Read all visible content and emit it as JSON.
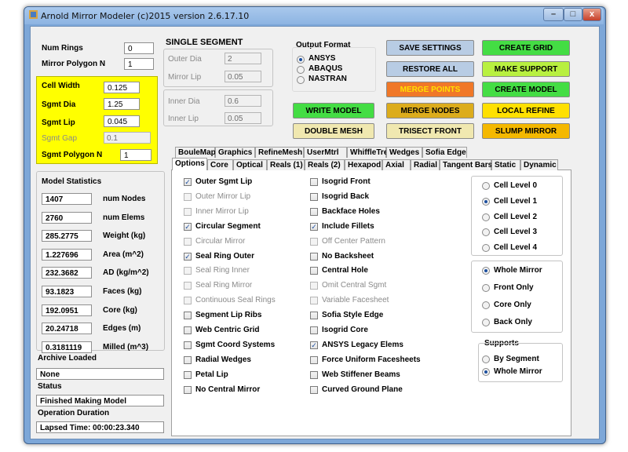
{
  "window": {
    "title": "Arnold Mirror Modeler (c)2015  version 2.6.17.10",
    "controls": {
      "minimize": "–",
      "maximize": "□",
      "close": "x"
    }
  },
  "left": {
    "num_rings_label": "Num Rings",
    "num_rings": "0",
    "mirror_polygon_label": "Mirror Polygon N",
    "mirror_polygon": "1",
    "cell_width_label": "Cell Width",
    "cell_width": "0.125",
    "sgmt_dia_label": "Sgmt Dia",
    "sgmt_dia": "1.25",
    "sgmt_lip_label": "Sgmt Lip",
    "sgmt_lip": "0.045",
    "sgmt_gap_label": "Sgmt Gap",
    "sgmt_gap": "0.1",
    "sgmt_polygon_label": "Sgmt Polygon N",
    "sgmt_polygon": "1"
  },
  "single_segment": {
    "title": "SINGLE SEGMENT",
    "outer_dia_label": "Outer Dia",
    "outer_dia": "2",
    "mirror_lip_label": "Mirror Lip",
    "mirror_lip": "0.05",
    "inner_dia_label": "Inner Dia",
    "inner_dia": "0.6",
    "inner_lip_label": "Inner Lip",
    "inner_lip": "0.05"
  },
  "output_format": {
    "title": "Output Format",
    "options": [
      "ANSYS",
      "ABAQUS",
      "NASTRAN"
    ],
    "selected": "ANSYS"
  },
  "buttons": {
    "write_model": "WRITE MODEL",
    "double_mesh": "DOUBLE MESH",
    "save_settings": "SAVE SETTINGS",
    "restore_all": "RESTORE ALL",
    "merge_points": "MERGE POINTS",
    "merge_nodes": "MERGE NODES",
    "trisect_front": "TRISECT FRONT",
    "create_grid": "CREATE GRID",
    "make_support": "MAKE SUPPORT",
    "create_model": "CREATE MODEL",
    "local_refine": "LOCAL REFINE",
    "slump_mirror": "SLUMP MIRROR"
  },
  "colors": {
    "yellow_panel": "#ffff00",
    "blue_btn": "#b8cce4",
    "green_btn": "#44dd44",
    "lime_btn": "#b8f040",
    "orange_btn": "#f07828",
    "gold_btn": "#dcac1c",
    "cream_btn": "#f0e8b0",
    "yellow_btn": "#ffe000",
    "amber_btn": "#f4b800"
  },
  "stats": {
    "title": "Model Statistics",
    "rows": [
      {
        "value": "1407",
        "label": "num Nodes"
      },
      {
        "value": "2760",
        "label": "num Elems"
      },
      {
        "value": "285.2775",
        "label": "Weight (kg)"
      },
      {
        "value": "1.227696",
        "label": "Area (m^2)"
      },
      {
        "value": "232.3682",
        "label": "AD (kg/m^2)"
      },
      {
        "value": "93.1823",
        "label": "Faces (kg)"
      },
      {
        "value": "192.0951",
        "label": "Core (kg)"
      },
      {
        "value": "20.24718",
        "label": "Edges (m)"
      },
      {
        "value": "0.3181119",
        "label": "Milled (m^3)"
      }
    ],
    "archive_label": "Archive Loaded",
    "archive": "None",
    "status_label": "Status",
    "status": "Finished Making Model",
    "duration_label": "Operation Duration",
    "duration": "Lapsed Time: 00:00:23.340"
  },
  "tabs_row1": [
    "BouleMap",
    "Graphics",
    "RefineMesh",
    "UserMtrl",
    "WhiffleTree",
    "Wedges",
    "Sofia Edge"
  ],
  "tabs_row2": [
    "Options",
    "Core",
    "Optical",
    "Reals (1)",
    "Reals (2)",
    "Hexapod",
    "Axial",
    "Radial",
    "Tangent Bars",
    "Static",
    "Dynamic"
  ],
  "active_tab": "Options",
  "options_col1": [
    {
      "label": "Outer Sgmt Lip",
      "checked": true,
      "enabled": true
    },
    {
      "label": "Outer Mirror Lip",
      "checked": false,
      "enabled": false
    },
    {
      "label": "Inner Mirror Lip",
      "checked": false,
      "enabled": false
    },
    {
      "label": "Circular Segment",
      "checked": true,
      "enabled": true
    },
    {
      "label": "Circular Mirror",
      "checked": false,
      "enabled": false
    },
    {
      "label": "Seal Ring Outer",
      "checked": true,
      "enabled": true
    },
    {
      "label": "Seal Ring Inner",
      "checked": false,
      "enabled": false
    },
    {
      "label": "Seal Ring Mirror",
      "checked": false,
      "enabled": false
    },
    {
      "label": "Continuous Seal Rings",
      "checked": false,
      "enabled": false
    },
    {
      "label": "Segment Lip Ribs",
      "checked": false,
      "enabled": true
    },
    {
      "label": "Web Centric Grid",
      "checked": false,
      "enabled": true
    },
    {
      "label": "Sgmt Coord Systems",
      "checked": false,
      "enabled": true
    },
    {
      "label": "Radial Wedges",
      "checked": false,
      "enabled": true
    },
    {
      "label": "Petal Lip",
      "checked": false,
      "enabled": true
    },
    {
      "label": "No Central Mirror",
      "checked": false,
      "enabled": true
    }
  ],
  "options_col2": [
    {
      "label": "Isogrid Front",
      "checked": false,
      "enabled": true
    },
    {
      "label": "Isogrid Back",
      "checked": false,
      "enabled": true
    },
    {
      "label": "Backface Holes",
      "checked": false,
      "enabled": true
    },
    {
      "label": "Include Fillets",
      "checked": true,
      "enabled": true
    },
    {
      "label": "Off Center Pattern",
      "checked": false,
      "enabled": false
    },
    {
      "label": "No Backsheet",
      "checked": false,
      "enabled": true
    },
    {
      "label": "Central Hole",
      "checked": false,
      "enabled": true
    },
    {
      "label": "Omit Central Sgmt",
      "checked": false,
      "enabled": false
    },
    {
      "label": "Variable Facesheet",
      "checked": false,
      "enabled": false
    },
    {
      "label": "Sofia Style Edge",
      "checked": false,
      "enabled": true
    },
    {
      "label": "Isogrid Core",
      "checked": false,
      "enabled": true
    },
    {
      "label": "ANSYS Legacy Elems",
      "checked": true,
      "enabled": true
    },
    {
      "label": "Force Uniform Facesheets",
      "checked": false,
      "enabled": true
    },
    {
      "label": "Web Stiffener Beams",
      "checked": false,
      "enabled": true
    },
    {
      "label": "Curved Ground Plane",
      "checked": false,
      "enabled": true
    }
  ],
  "cell_levels": {
    "options": [
      "Cell Level 0",
      "Cell Level 1",
      "Cell Level 2",
      "Cell Level 3",
      "Cell Level 4"
    ],
    "selected": "Cell Level 1"
  },
  "region": {
    "options": [
      "Whole Mirror",
      "Front Only",
      "Core Only",
      "Back Only"
    ],
    "selected": "Whole Mirror"
  },
  "supports": {
    "title": "Supports",
    "options": [
      "By Segment",
      "Whole Mirror"
    ],
    "selected": "Whole Mirror"
  }
}
